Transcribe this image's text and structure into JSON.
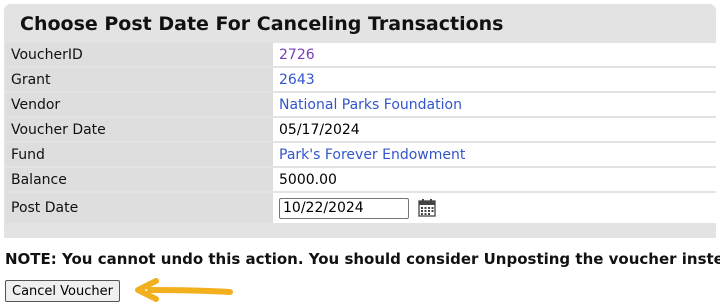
{
  "panel": {
    "title": "Choose Post Date For Canceling Transactions"
  },
  "rows": [
    {
      "label": "VoucherID",
      "value": "2726"
    },
    {
      "label": "Grant",
      "value": "2643"
    },
    {
      "label": "Vendor",
      "value": "National Parks Foundation"
    },
    {
      "label": "Voucher Date",
      "value": "05/17/2024"
    },
    {
      "label": "Fund",
      "value": "Park's Forever Endowment"
    },
    {
      "label": "Balance",
      "value": "5000.00"
    },
    {
      "label": "Post Date",
      "value": "10/22/2024"
    }
  ],
  "post_date_icon": "calendar-icon",
  "note": "NOTE: You cannot undo this action. You should consider Unposting the voucher instead.",
  "actions": {
    "cancel_label": "Cancel Voucher"
  },
  "colors": {
    "panel_bg": "#e3e3e3",
    "link": "#3355cc",
    "visited_link": "#7a3fb8",
    "arrow": "#f2b01e"
  }
}
